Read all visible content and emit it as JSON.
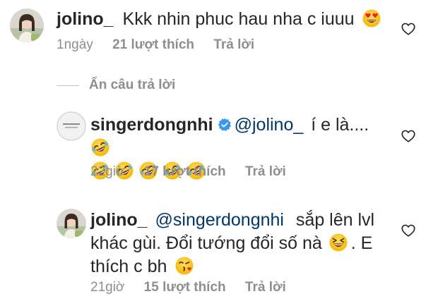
{
  "comments": [
    {
      "username": "jolino_",
      "text": "Kkk nhin phuc hau nha c iuuu",
      "emoji": "heart-eyes-emoji",
      "time": "1ngày",
      "likes": "21 lượt thích",
      "reply": "Trả lời"
    }
  ],
  "hide_replies": "Ẩn câu trả lời",
  "replies": [
    {
      "username": "singerdongnhi",
      "verified_icon": "verified-badge-icon",
      "mention": "@jolino_",
      "text": "í e là....",
      "emoji": "rolling-laughing-emoji",
      "time": "22giờ",
      "likes": "17 lượt thích",
      "reply": "Trả lời"
    },
    {
      "username": "jolino_",
      "mention": "@singerdongnhi",
      "text_1": "sắp lên lvl",
      "text_2": "khác gùi. Đổi tướng đổi số nà",
      "text_3": ". E",
      "text_4": "thích c bh",
      "emoji_1": "grinning-squinting-emoji",
      "emoji_2": "face-blowing-kiss-emoji",
      "time": "21giờ",
      "likes": "15 lượt thích",
      "reply": "Trả lời"
    }
  ],
  "colors": {
    "text": "#262626",
    "muted": "#8e8e8e",
    "mention": "#00376b",
    "verified": "#3897f0"
  }
}
